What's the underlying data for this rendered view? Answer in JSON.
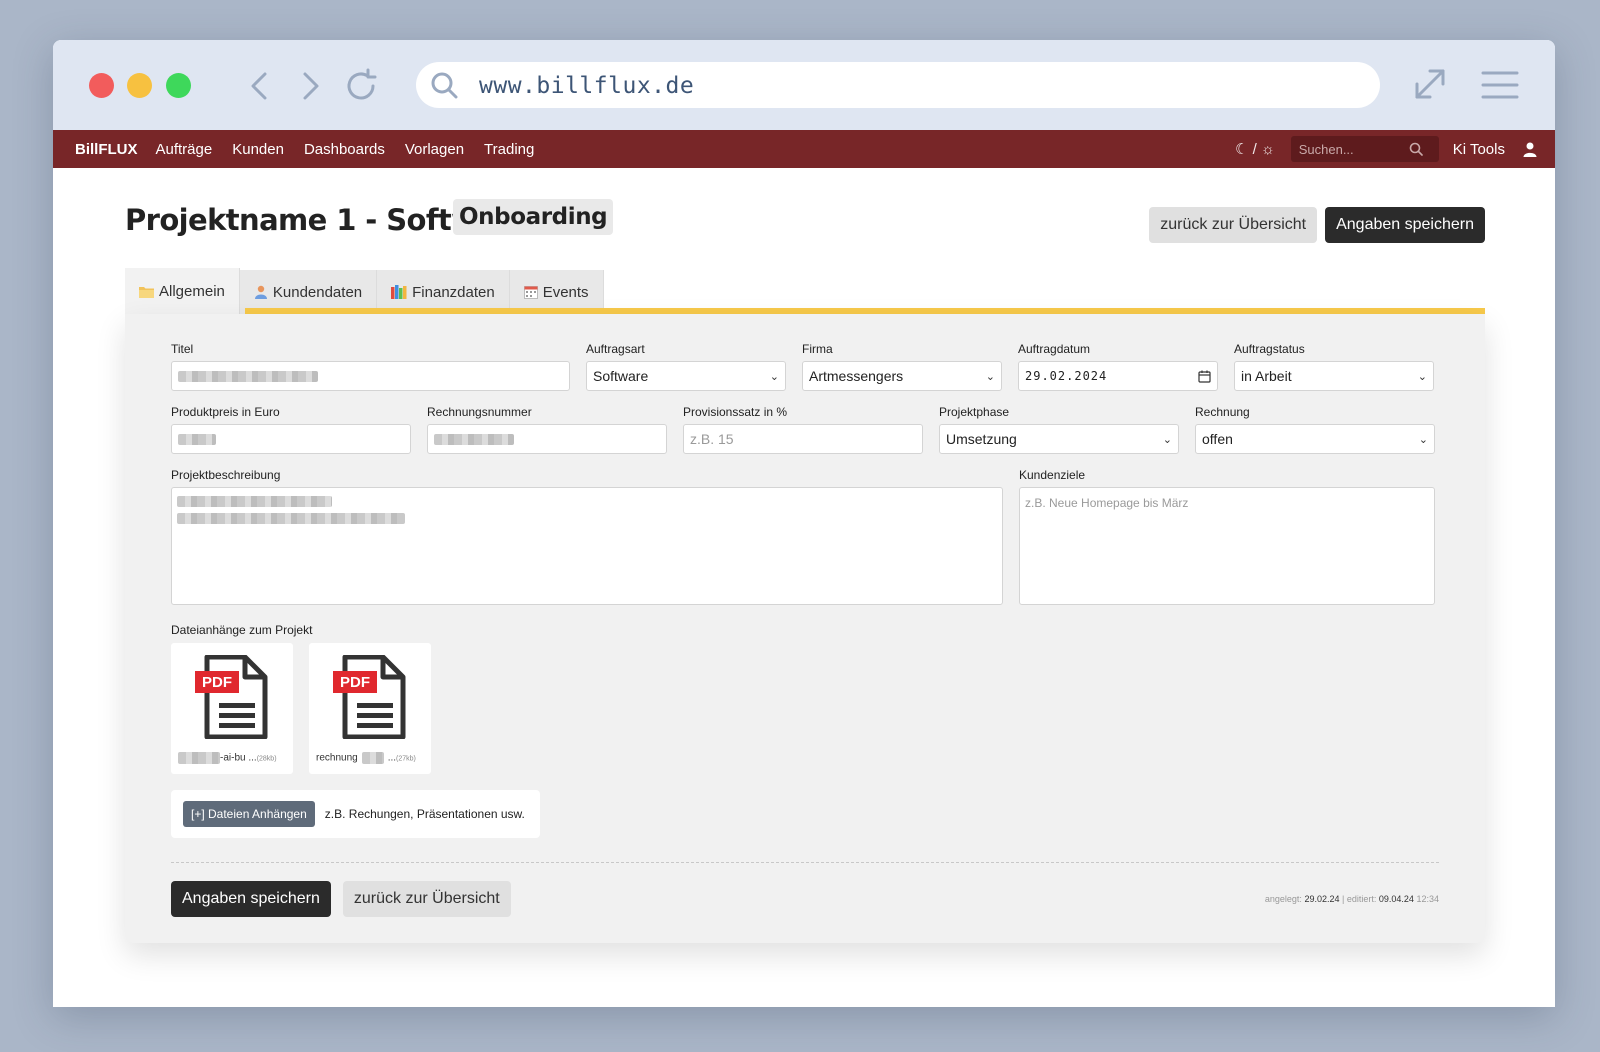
{
  "browser": {
    "url": "www.billflux.de"
  },
  "nav": {
    "brand": "BillFLUX",
    "links": [
      "Aufträge",
      "Kunden",
      "Dashboards",
      "Vorlagen",
      "Trading"
    ],
    "theme_toggle": "☾ / ☼",
    "search_placeholder": "Suchen...",
    "ki_tools": "Ki Tools"
  },
  "header": {
    "title": "Projektname 1 - Software",
    "badge": "Onboarding",
    "back_label": "zurück zur Übersicht",
    "save_label": "Angaben speichern"
  },
  "tabs": [
    {
      "label": "Allgemein",
      "active": true,
      "icon": "folder-icon"
    },
    {
      "label": "Kundendaten",
      "active": false,
      "icon": "person-icon"
    },
    {
      "label": "Finanzdaten",
      "active": false,
      "icon": "books-icon"
    },
    {
      "label": "Events",
      "active": false,
      "icon": "calendar-icon"
    }
  ],
  "form": {
    "titel": {
      "label": "Titel",
      "value": ""
    },
    "auftragsart": {
      "label": "Auftragsart",
      "value": "Software"
    },
    "firma": {
      "label": "Firma",
      "value": "Artmessengers"
    },
    "auftragdatum": {
      "label": "Auftragdatum",
      "value": "29.02.2024"
    },
    "auftragstatus": {
      "label": "Auftragstatus",
      "value": "in Arbeit"
    },
    "produktpreis": {
      "label": "Produktpreis in Euro",
      "value": ""
    },
    "rechnungsnummer": {
      "label": "Rechnungsnummer",
      "value": ""
    },
    "provisionssatz": {
      "label": "Provisionssatz in %",
      "placeholder": "z.B. 15"
    },
    "projektphase": {
      "label": "Projektphase",
      "value": "Umsetzung"
    },
    "rechnung": {
      "label": "Rechnung",
      "value": "offen"
    },
    "projektbeschreibung": {
      "label": "Projektbeschreibung"
    },
    "kundenziele": {
      "label": "Kundenziele",
      "placeholder": "z.B. Neue Homepage bis März"
    }
  },
  "attachments": {
    "label": "Dateianhänge zum Projekt",
    "files": [
      {
        "type": "PDF",
        "name": "-ai-bu ...",
        "size": "(28kb)"
      },
      {
        "type": "PDF",
        "name": "rechnung",
        "name_suffix": "...",
        "size": "(27kb)"
      }
    ],
    "attach_button": "[+] Dateien Anhängen",
    "attach_hint": "z.B. Rechungen, Präsentationen usw."
  },
  "footer": {
    "save_label": "Angaben speichern",
    "back_label": "zurück zur Übersicht",
    "created_label": "angelegt:",
    "created_date": "29.02.24",
    "sep": "|",
    "edited_label": "editiert:",
    "edited_date": "09.04.24",
    "edited_time": "12:34"
  },
  "colors": {
    "nav_bg": "#782628",
    "tab_accent": "#f7c94a",
    "dark_button": "#2b2b2b",
    "pdf_red": "#e0282e"
  }
}
